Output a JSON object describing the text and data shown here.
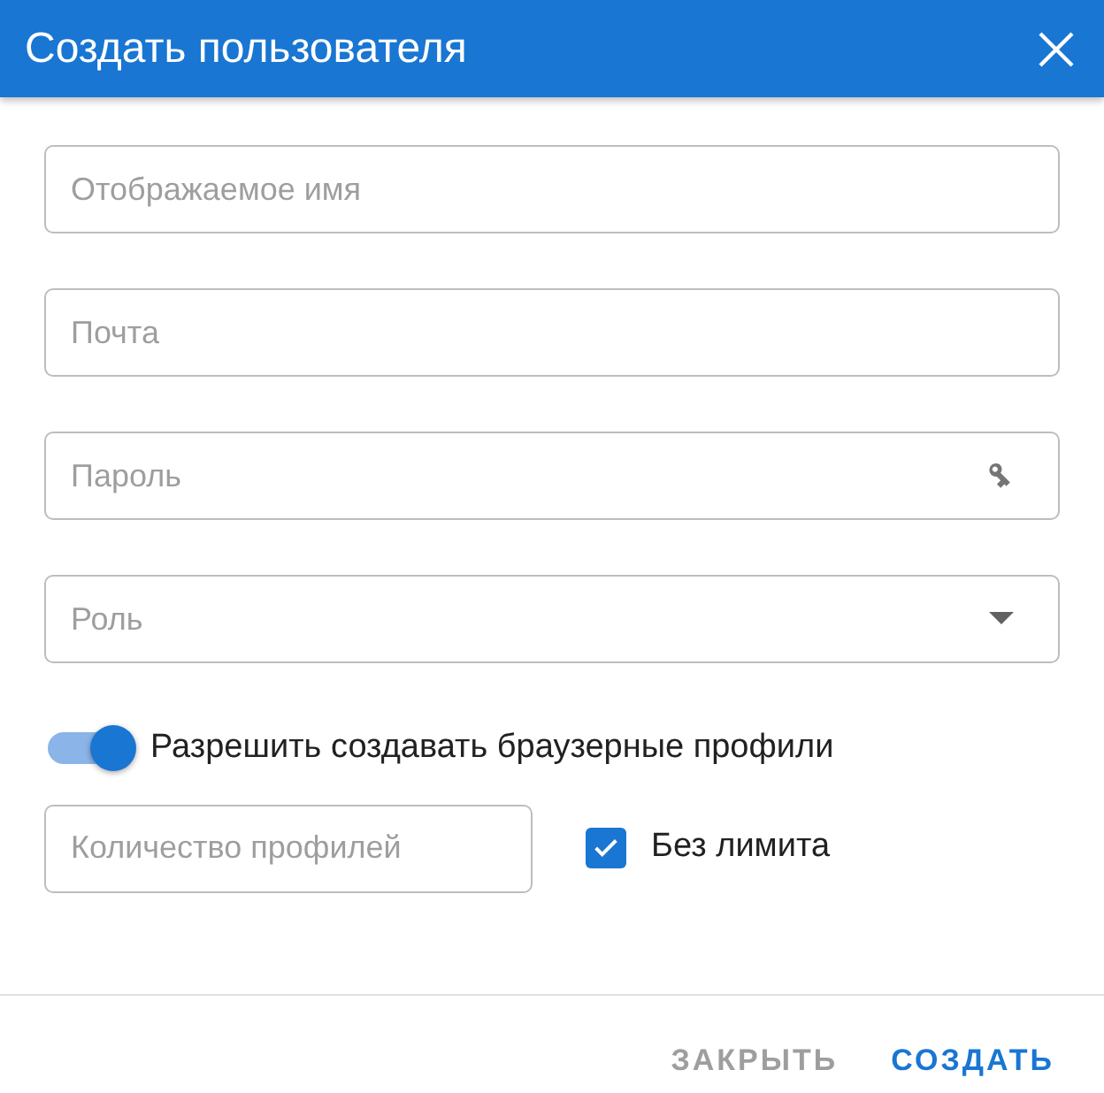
{
  "dialog": {
    "title": "Создать пользователя"
  },
  "fields": [
    {
      "kind": "text",
      "placeholder": "Отображаемое имя"
    },
    {
      "kind": "text",
      "placeholder": "Почта"
    },
    {
      "kind": "password",
      "placeholder": "Пароль"
    },
    {
      "kind": "select",
      "placeholder": "Роль"
    }
  ],
  "switch": {
    "label": "Разрешить создавать браузерные профили",
    "on": true
  },
  "profile_count": {
    "placeholder": "Количество профилей"
  },
  "no_limit": {
    "label": "Без лимита",
    "checked": true
  },
  "buttons": [
    {
      "kind": "secondary",
      "label": "ЗАКРЫТЬ"
    },
    {
      "kind": "primary",
      "label": "СОЗДАТЬ"
    }
  ]
}
